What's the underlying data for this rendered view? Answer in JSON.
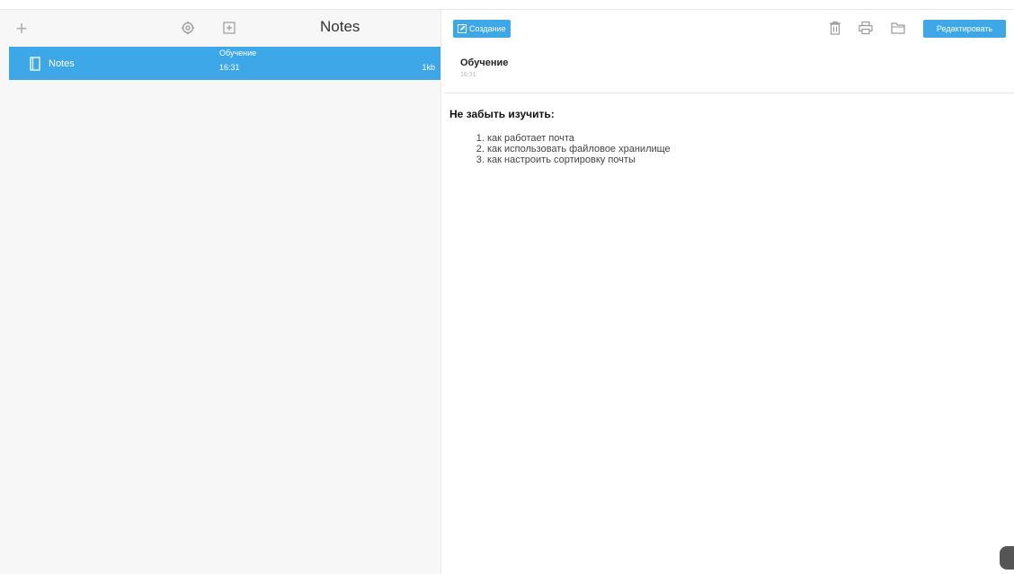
{
  "toolbar": {
    "notes_title": "Notes",
    "create_label": "Создание",
    "edit_label": "Редактировать"
  },
  "folders": [
    {
      "label": "Notes",
      "selected": true
    }
  ],
  "notes": [
    {
      "title": "Обучение",
      "time": "16:31",
      "size": "1kb",
      "selected": true
    }
  ],
  "note": {
    "title": "Обучение",
    "date": "16:31",
    "heading": "Не забыть изучить:",
    "items": [
      "как работает почта",
      "как использовать файловое хранилище",
      "как настроить сортировку почты"
    ]
  },
  "colors": {
    "accent": "#3ea7e8",
    "panel": "#f7f7f7"
  }
}
